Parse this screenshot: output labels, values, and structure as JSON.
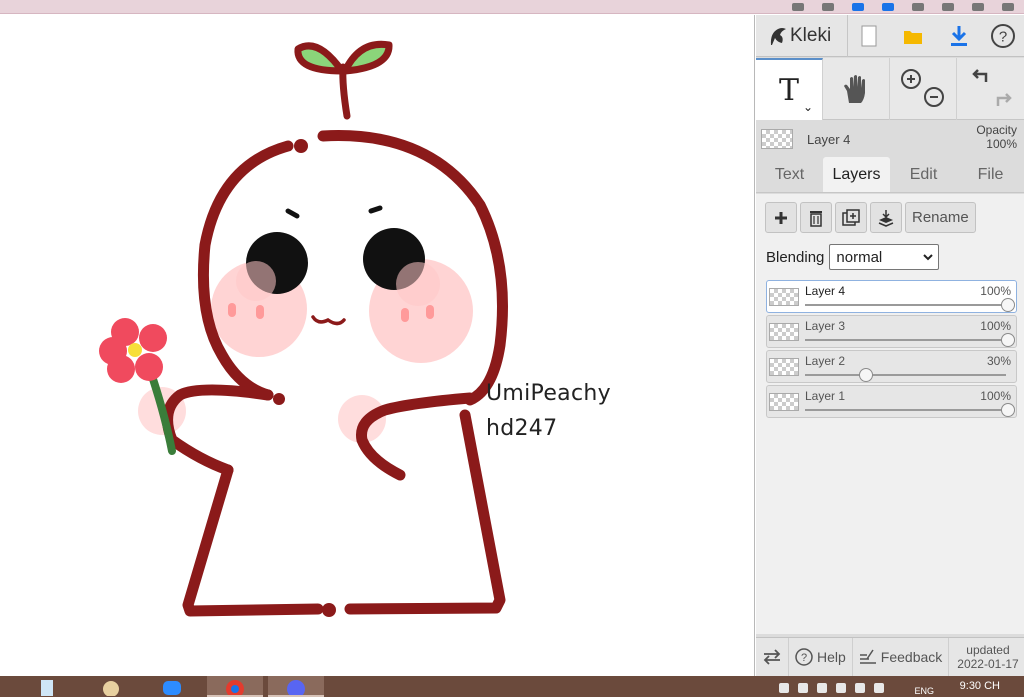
{
  "app": {
    "name": "Kleki"
  },
  "canvas": {
    "signature_line1": "UmiPeachy",
    "signature_line2": "hd247",
    "stroke_color": "#8b1a1a",
    "blush_color": "#ffc6c6",
    "flower_color": "#f04a5e",
    "sprout_color": "#8bd57a"
  },
  "toolbar": {
    "active_tool": "text",
    "tool_text_glyph": "T",
    "caret_glyph": "⌄"
  },
  "current_layer": {
    "name": "Layer 4",
    "opacity_label": "Opacity",
    "opacity_value": "100%"
  },
  "tabs": [
    {
      "label": "Text",
      "active": false
    },
    {
      "label": "Layers",
      "active": true
    },
    {
      "label": "Edit",
      "active": false
    },
    {
      "label": "File",
      "active": false
    }
  ],
  "layer_actions": {
    "rename_label": "Rename"
  },
  "blending": {
    "label": "Blending",
    "value": "normal"
  },
  "layers": [
    {
      "name": "Layer 4",
      "opacity": "100%",
      "level": 1.0,
      "selected": true
    },
    {
      "name": "Layer 3",
      "opacity": "100%",
      "level": 1.0,
      "selected": false
    },
    {
      "name": "Layer 2",
      "opacity": "30%",
      "level": 0.3,
      "selected": false
    },
    {
      "name": "Layer 1",
      "opacity": "100%",
      "level": 1.0,
      "selected": false
    }
  ],
  "footer": {
    "help_label": "Help",
    "feedback_label": "Feedback",
    "updated_line1": "updated",
    "updated_line2": "2022-01-17"
  },
  "taskbar": {
    "clock": "9:30 CH",
    "language": "ENG"
  },
  "colors": {
    "accent": "#5b8fc9",
    "download": "#1a73e8",
    "folder": "#f5b800"
  }
}
